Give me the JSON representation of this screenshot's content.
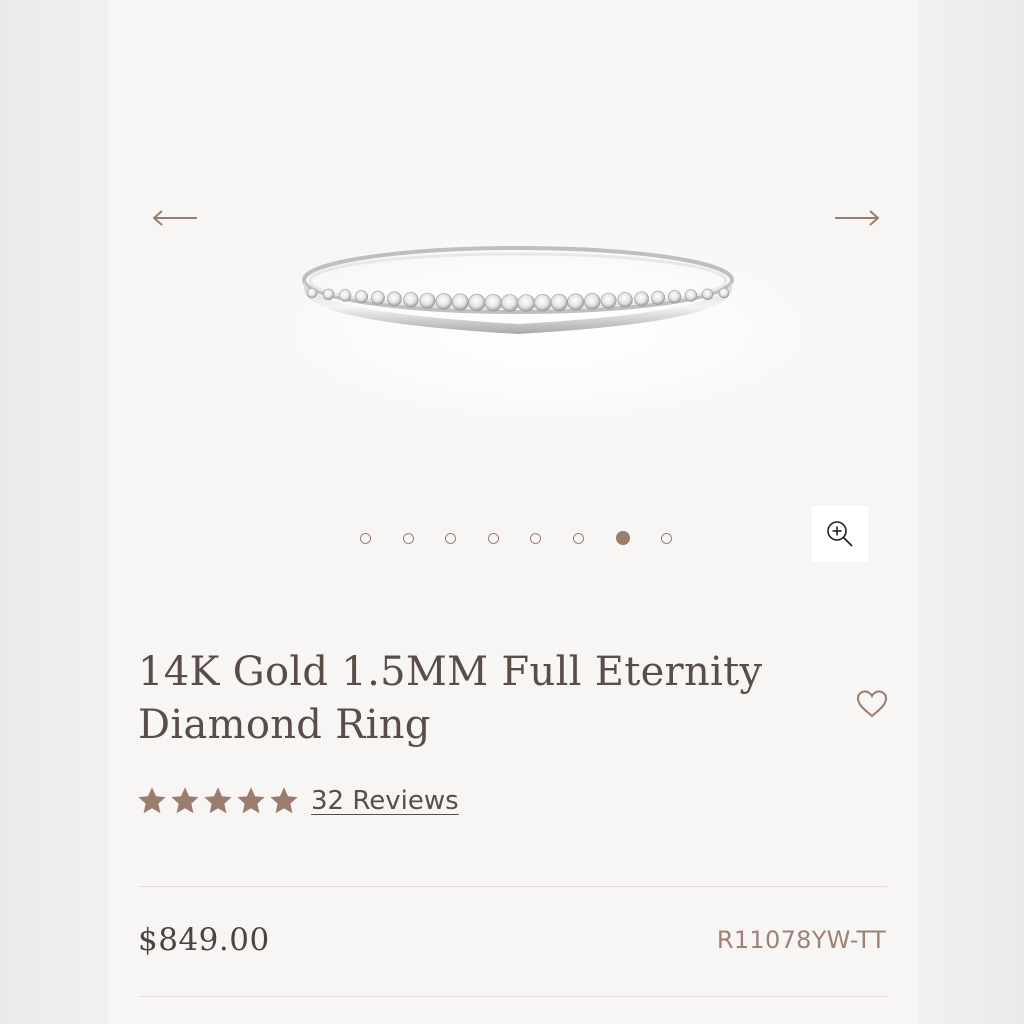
{
  "colors": {
    "accent": "#9b7d6e",
    "text": "#5a4c47",
    "page_bg": "#f7f6f5",
    "divider": "#e5dcdc"
  },
  "gallery": {
    "prev_icon": "arrow-left-icon",
    "next_icon": "arrow-right-icon",
    "zoom_icon": "zoom-in-icon",
    "total_images": 8,
    "active_index": 6
  },
  "product": {
    "title_line1": "14K Gold 1.5MM Full Eternity",
    "title_line2": "Diamond Ring",
    "wishlist_icon": "heart-icon",
    "rating_value": 5,
    "rating_max": 5,
    "reviews_label": "32 Reviews",
    "price": "$849.00",
    "sku": "R11078YW-TT"
  }
}
